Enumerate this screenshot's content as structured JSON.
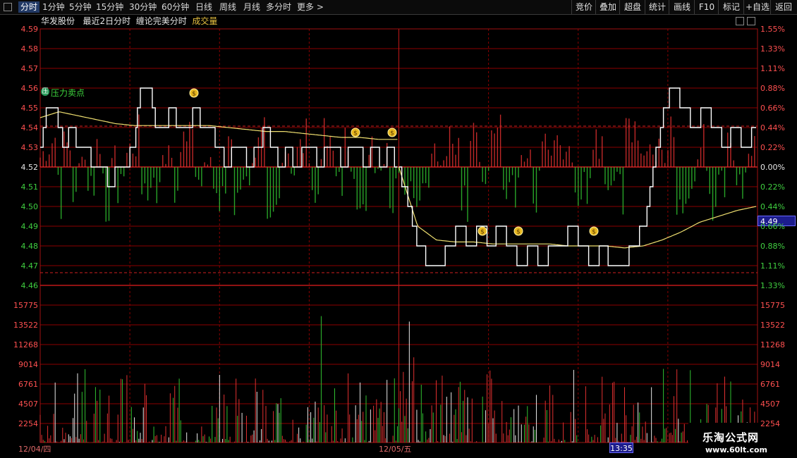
{
  "toolbar": {
    "tabs": [
      "分时",
      "1分钟",
      "5分钟",
      "15分钟",
      "30分钟",
      "60分钟",
      "日线",
      "周线",
      "月线",
      "多分时",
      "更多 >"
    ],
    "active": "分时",
    "right": [
      "竞价",
      "叠加",
      "超盘",
      "统计",
      "画线",
      "F10",
      "标记",
      "+自选",
      "返回"
    ]
  },
  "subtitle": {
    "stock": "华发股份",
    "period": "最近2日分时",
    "indicator": "缠论完美分时",
    "sub_indicator": "成交量"
  },
  "price_axis": {
    "left": [
      "4.59",
      "4.58",
      "4.57",
      "4.56",
      "4.55",
      "4.54",
      "4.53",
      "4.52",
      "4.51",
      "4.50",
      "4.49",
      "4.48",
      "4.47",
      "4.46"
    ],
    "right": [
      "1.55%",
      "1.33%",
      "1.11%",
      "0.88%",
      "0.66%",
      "0.44%",
      "0.22%",
      "0.00%",
      "0.22%",
      "0.44%",
      "0.66%",
      "0.88%",
      "1.11%",
      "1.33%"
    ],
    "base": "4.52"
  },
  "volume_axis": {
    "labels": [
      "15775",
      "13522",
      "11268",
      "9014",
      "6761",
      "4507",
      "2254"
    ]
  },
  "cursor": {
    "price": "4.49",
    "time": "13:35"
  },
  "dates": [
    "12/04/四",
    "12/05/五"
  ],
  "annotation": "压力卖点",
  "watermark": {
    "title": "乐淘公式网",
    "url": "www.60lt.com"
  },
  "colors": {
    "up": "#e03030",
    "down": "#30c030",
    "price_line": "#ffffff",
    "avg_line": "#f0e070",
    "grid": "#8b0000",
    "axis_up": "#ff5050",
    "axis_down": "#40d040"
  },
  "chart_data": {
    "type": "line",
    "title": "华发股份 最近2日分时",
    "base_price": 4.52,
    "ylim": [
      4.46,
      4.59
    ],
    "days": [
      {
        "date": "12/04/四",
        "price_keypoints": [
          4.53,
          4.55,
          4.55,
          4.53,
          4.54,
          4.53,
          4.53,
          4.52,
          4.52,
          4.51,
          4.52,
          4.52,
          4.53,
          4.56,
          4.56,
          4.54,
          4.54,
          4.55,
          4.54,
          4.54,
          4.55,
          4.54,
          4.54,
          4.53,
          4.52,
          4.53,
          4.53,
          4.52,
          4.53,
          4.54,
          4.53,
          4.52,
          4.53,
          4.52,
          4.53,
          4.53,
          4.52,
          4.53,
          4.53,
          4.52,
          4.53,
          4.53,
          4.52,
          4.53,
          4.52,
          4.53,
          4.52
        ],
        "avg_keypoints": [
          4.545,
          4.548,
          4.546,
          4.544,
          4.542,
          4.541,
          4.541,
          4.541,
          4.541,
          4.541,
          4.54,
          4.539,
          4.538,
          4.538,
          4.537,
          4.536,
          4.535,
          4.535,
          4.534,
          4.534
        ],
        "volume_peak": 15775
      },
      {
        "date": "12/05/五",
        "price_keypoints": [
          4.52,
          4.5,
          4.48,
          4.47,
          4.47,
          4.48,
          4.49,
          4.48,
          4.49,
          4.48,
          4.49,
          4.48,
          4.47,
          4.48,
          4.47,
          4.48,
          4.48,
          4.49,
          4.48,
          4.47,
          4.48,
          4.47,
          4.47,
          4.48,
          4.49,
          4.52,
          4.55,
          4.56,
          4.55,
          4.54,
          4.55,
          4.54,
          4.53,
          4.54,
          4.53,
          4.54
        ],
        "avg_keypoints": [
          4.52,
          4.49,
          4.483,
          4.482,
          4.482,
          4.481,
          4.481,
          4.481,
          4.481,
          4.48,
          4.48,
          4.48,
          4.479,
          4.48,
          4.483,
          4.487,
          4.492,
          4.495,
          4.498,
          4.5
        ],
        "volume_peak": 14000
      }
    ],
    "markers": [
      "💰"
    ]
  }
}
